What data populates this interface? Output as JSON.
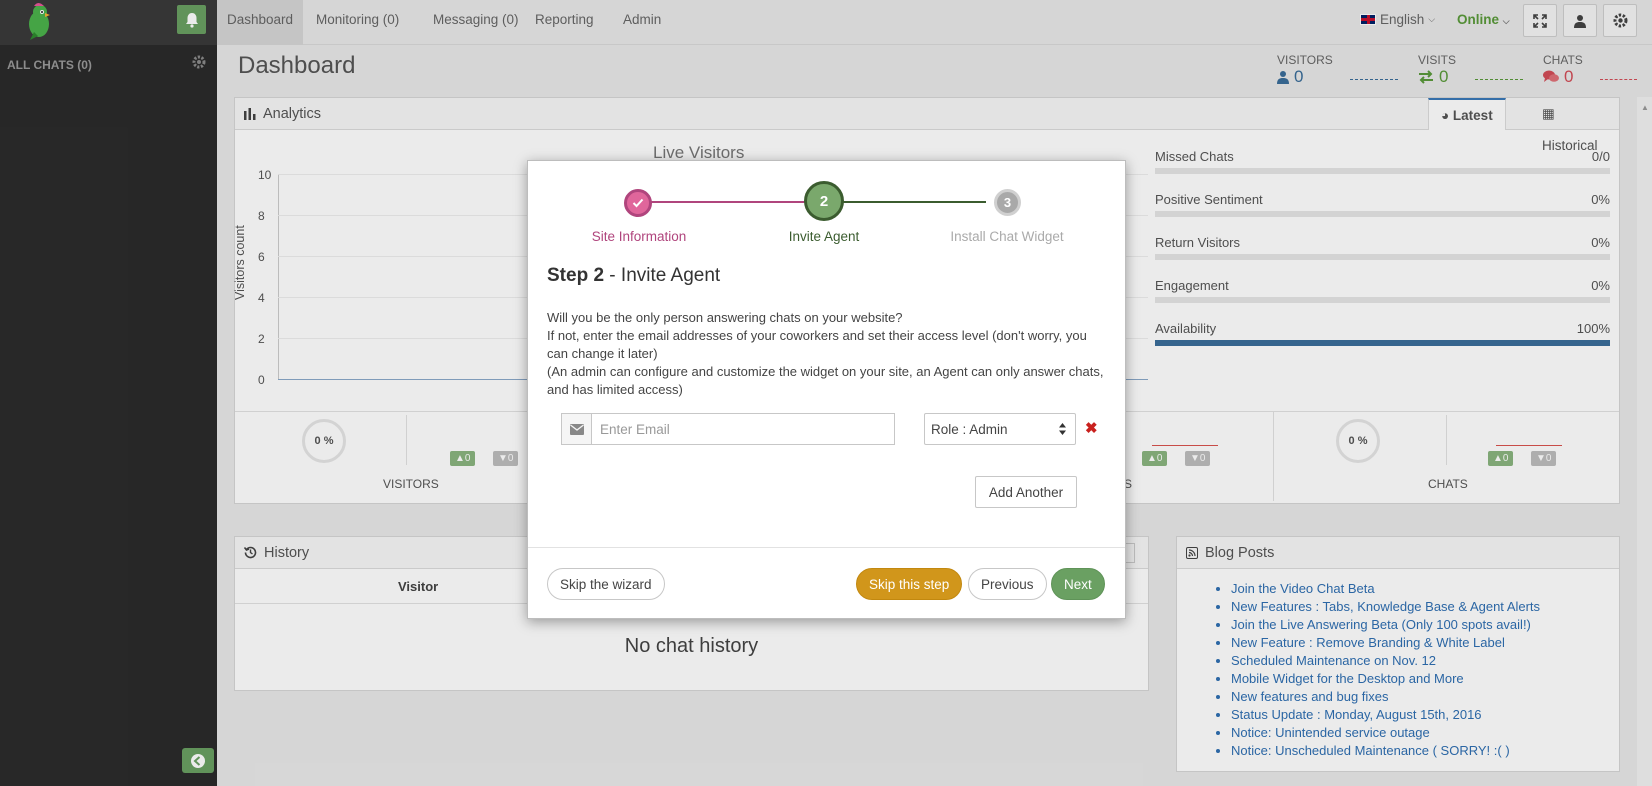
{
  "colors": {
    "accent_green": "#6aa062",
    "link_blue": "#2f6fb2",
    "step_done": "#e0669b",
    "step_active": "#7aa86c",
    "step_pending": "#a9a9a9",
    "warning": "#d1961b"
  },
  "sidebar": {
    "all_chats": "ALL CHATS (0)"
  },
  "nav": {
    "items": [
      "Dashboard",
      "Monitoring (0)",
      "Messaging (0)",
      "Reporting",
      "Admin"
    ],
    "language": "English",
    "status": "Online"
  },
  "header": {
    "title": "Dashboard",
    "stats": [
      {
        "label": "VISITORS",
        "value": "0",
        "color": "#3a6d99"
      },
      {
        "label": "VISITS",
        "value": "0",
        "color": "#5a9a3a"
      },
      {
        "label": "CHATS",
        "value": "0",
        "color": "#d24d57"
      }
    ]
  },
  "analytics": {
    "title": "Analytics",
    "tabs": [
      "Latest",
      "Historical"
    ],
    "chart_title": "Live Visitors",
    "ylabel": "Visitors count",
    "yticks": [
      "10",
      "8",
      "6",
      "4",
      "2",
      "0"
    ],
    "metrics": [
      {
        "label": "Missed Chats",
        "value": "0/0",
        "fill": 0
      },
      {
        "label": "Positive Sentiment",
        "value": "0%",
        "fill": 0
      },
      {
        "label": "Return Visitors",
        "value": "0%",
        "fill": 0
      },
      {
        "label": "Engagement",
        "value": "0%",
        "fill": 0
      },
      {
        "label": "Availability",
        "value": "100%",
        "fill": 1
      }
    ],
    "circles": [
      "0 %",
      "0 %"
    ],
    "strip_labels": [
      "VISITORS",
      "S",
      "CHATS"
    ],
    "badge_up": "0",
    "badge_down": "0"
  },
  "history": {
    "title": "History",
    "column": "Visitor",
    "empty": "No chat history"
  },
  "blog": {
    "title": "Blog Posts",
    "posts": [
      "Join the Video Chat Beta",
      "New Features : Tabs, Knowledge Base & Agent Alerts",
      "Join the Live Answering Beta (Only 100 spots avail!)",
      "New Feature : Remove Branding & White Label",
      "Scheduled Maintenance on Nov. 12",
      "Mobile Widget for the Desktop and More",
      "New features and bug fixes",
      "Status Update : Monday, August 15th, 2016",
      "Notice: Unintended service outage",
      "Notice: Unscheduled Maintenance ( SORRY! :( )"
    ]
  },
  "wizard": {
    "steps": [
      {
        "number": "",
        "label": "Site Information"
      },
      {
        "number": "2",
        "label": "Invite Agent"
      },
      {
        "number": "3",
        "label": "Install Chat Widget"
      }
    ],
    "title_step": "Step 2",
    "title_rest": " - Invite Agent",
    "para1": "Will you be the only person answering chats on your website?",
    "para2": "If not, enter the email addresses of your coworkers and set their access level (don't worry, you can change it later)",
    "para3": "(An admin can configure and customize the widget on your site, an Agent can only answer chats, and has limited access)",
    "email_placeholder": "Enter Email",
    "email_value": "",
    "role": "Role : Admin",
    "add_another": "Add Another",
    "skip_wizard": "Skip the wizard",
    "skip_step": "Skip this step",
    "previous": "Previous",
    "next": "Next"
  }
}
